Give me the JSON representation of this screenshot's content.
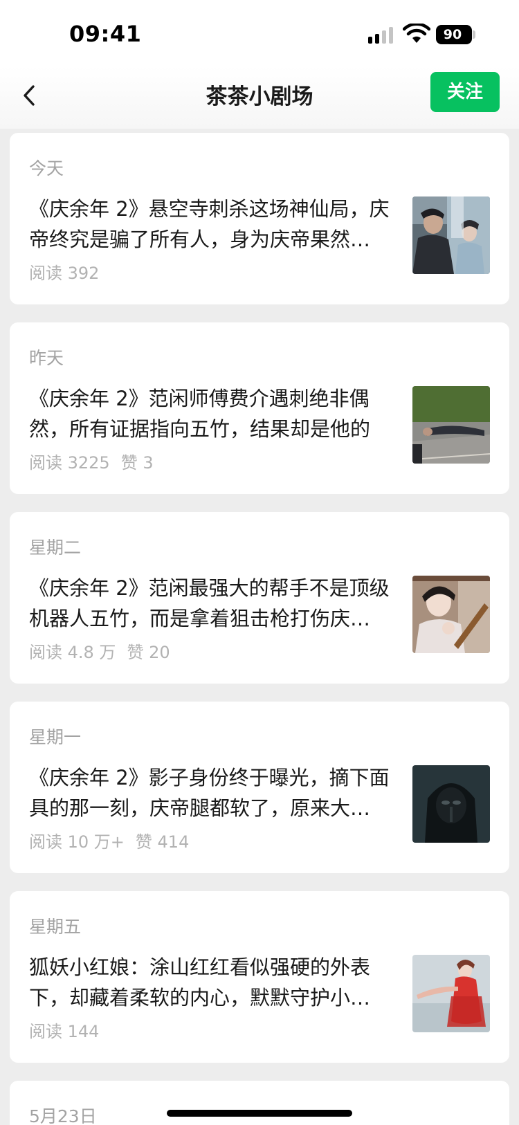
{
  "status_bar": {
    "time": "09:41",
    "battery": "90"
  },
  "nav": {
    "title": "茶茶小剧场",
    "follow_label": "关注"
  },
  "articles": [
    {
      "date": "今天",
      "title": "《庆余年 2》悬空寺刺杀这场神仙局，庆帝终究是骗了所有人，身为庆帝果然…",
      "reads": "阅读 392",
      "likes": ""
    },
    {
      "date": "昨天",
      "title": "《庆余年 2》范闲师傅费介遇刺绝非偶然，所有证据指向五竹，结果却是他的一…",
      "reads": "阅读 3225",
      "likes": "赞 3"
    },
    {
      "date": "星期二",
      "title": "《庆余年 2》范闲最强大的帮手不是顶级机器人五竹，而是拿着狙击枪打伤庆…",
      "reads": "阅读 4.8 万",
      "likes": "赞 20"
    },
    {
      "date": "星期一",
      "title": "《庆余年 2》影子身份终于曝光，摘下面具的那一刻，庆帝腿都软了，原来大…",
      "reads": "阅读 10 万+",
      "likes": "赞 414"
    },
    {
      "date": "星期五",
      "title": "狐妖小红娘：涂山红红看似强硬的外表下，却藏着柔软的内心，默默守护小…",
      "reads": "阅读 144",
      "likes": ""
    },
    {
      "date": "5月23日"
    }
  ],
  "colors": {
    "accent": "#07c160",
    "background": "#ededed"
  }
}
